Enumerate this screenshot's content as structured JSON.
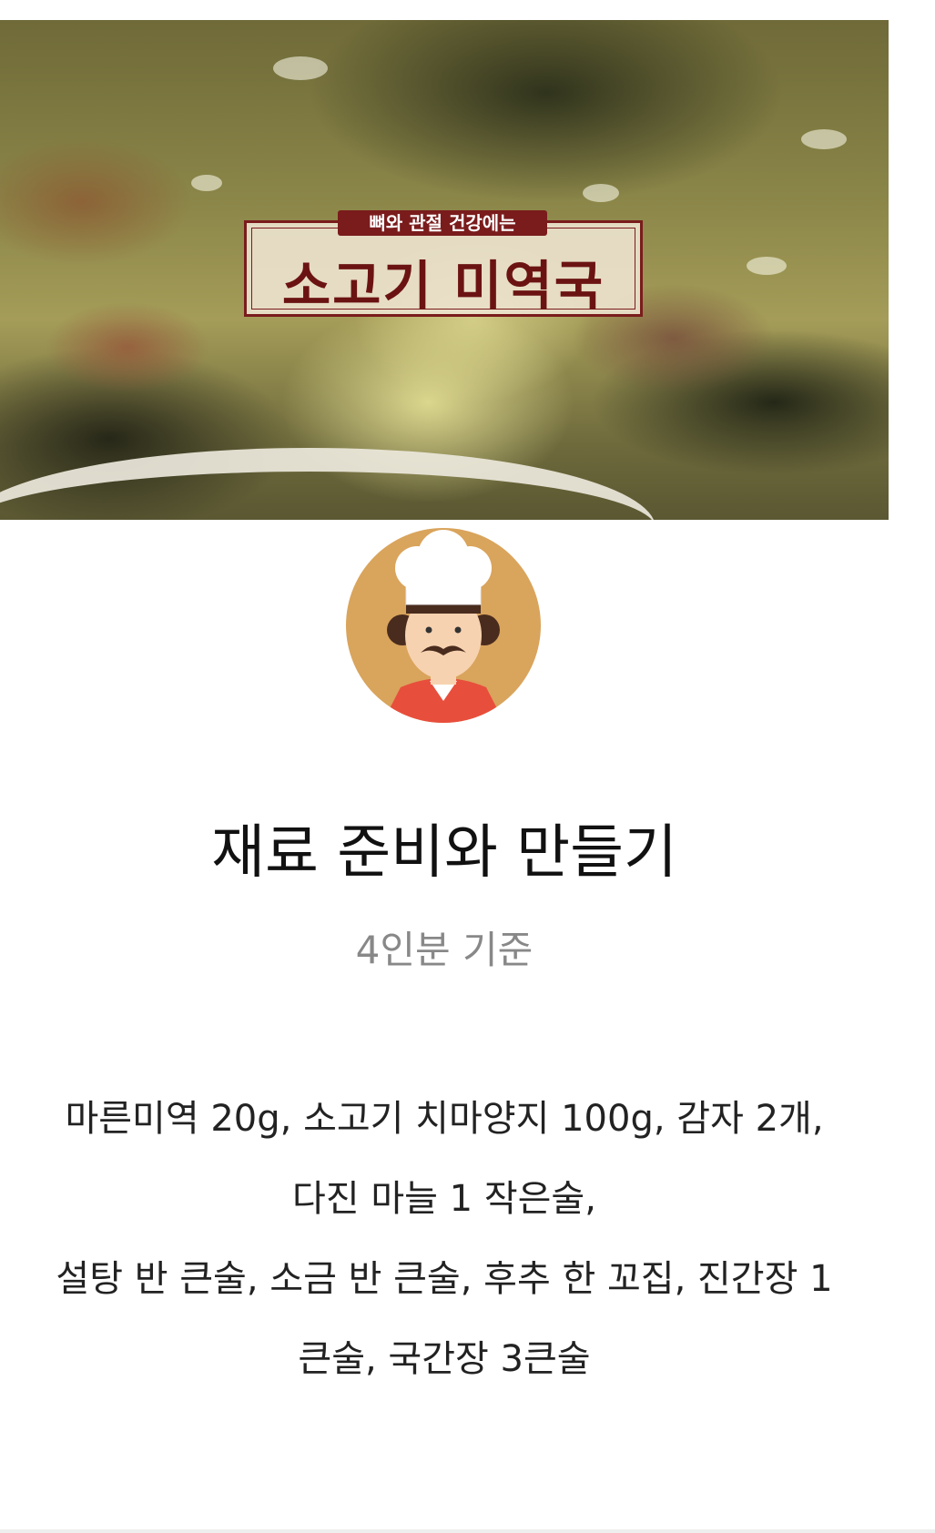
{
  "hero": {
    "badge_subtitle": "뼈와 관절 건강에는",
    "badge_title": "소고기 미역국"
  },
  "avatar": {
    "icon": "chef-icon",
    "background_color": "#D9A45C"
  },
  "section": {
    "heading": "재료 준비와 만들기",
    "servings": "4인분 기준"
  },
  "ingredients": {
    "line1": "마른미역 20g, 소고기 치마양지 100g, 감자 2개,",
    "line2": "다진 마늘 1 작은술,",
    "line3": "설탕 반 큰술, 소금 반 큰술, 후추 한 꼬집, 진간장 1",
    "line4": "큰술, 국간장 3큰술"
  }
}
